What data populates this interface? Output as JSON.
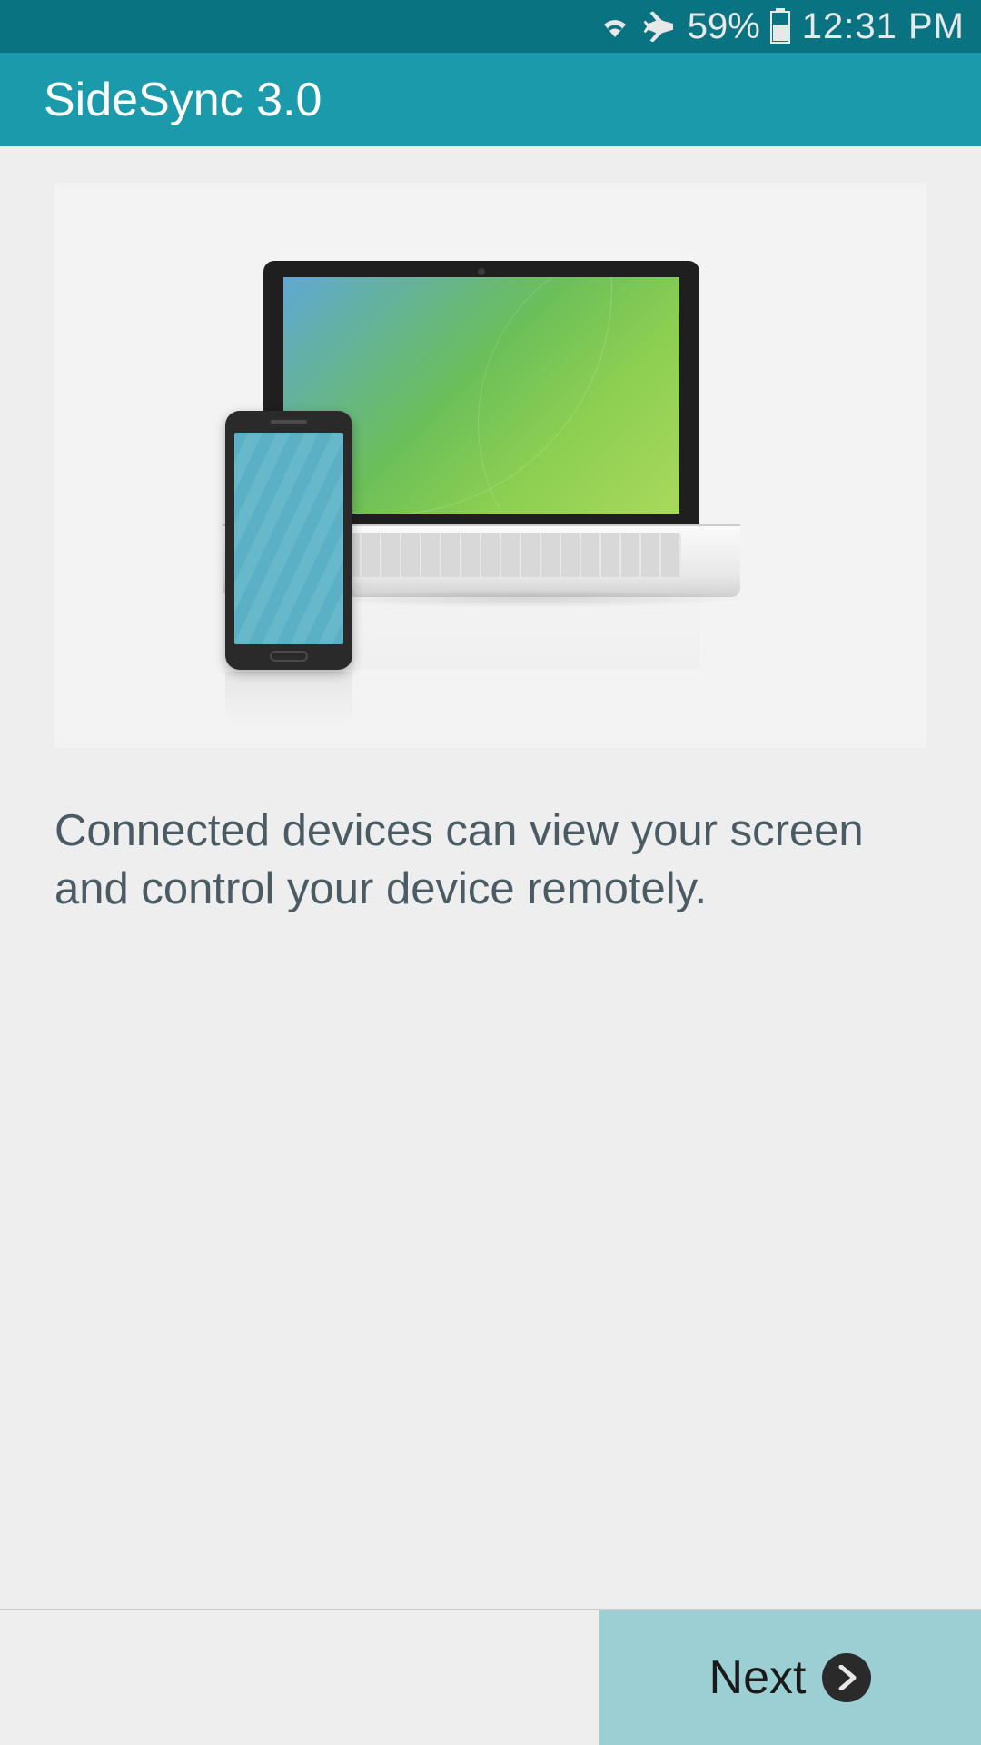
{
  "status_bar": {
    "battery_percent": "59%",
    "time": "12:31 PM"
  },
  "header": {
    "title": "SideSync 3.0"
  },
  "main": {
    "description": "Connected devices can view your screen and control your device remotely."
  },
  "footer": {
    "next_label": "Next"
  }
}
